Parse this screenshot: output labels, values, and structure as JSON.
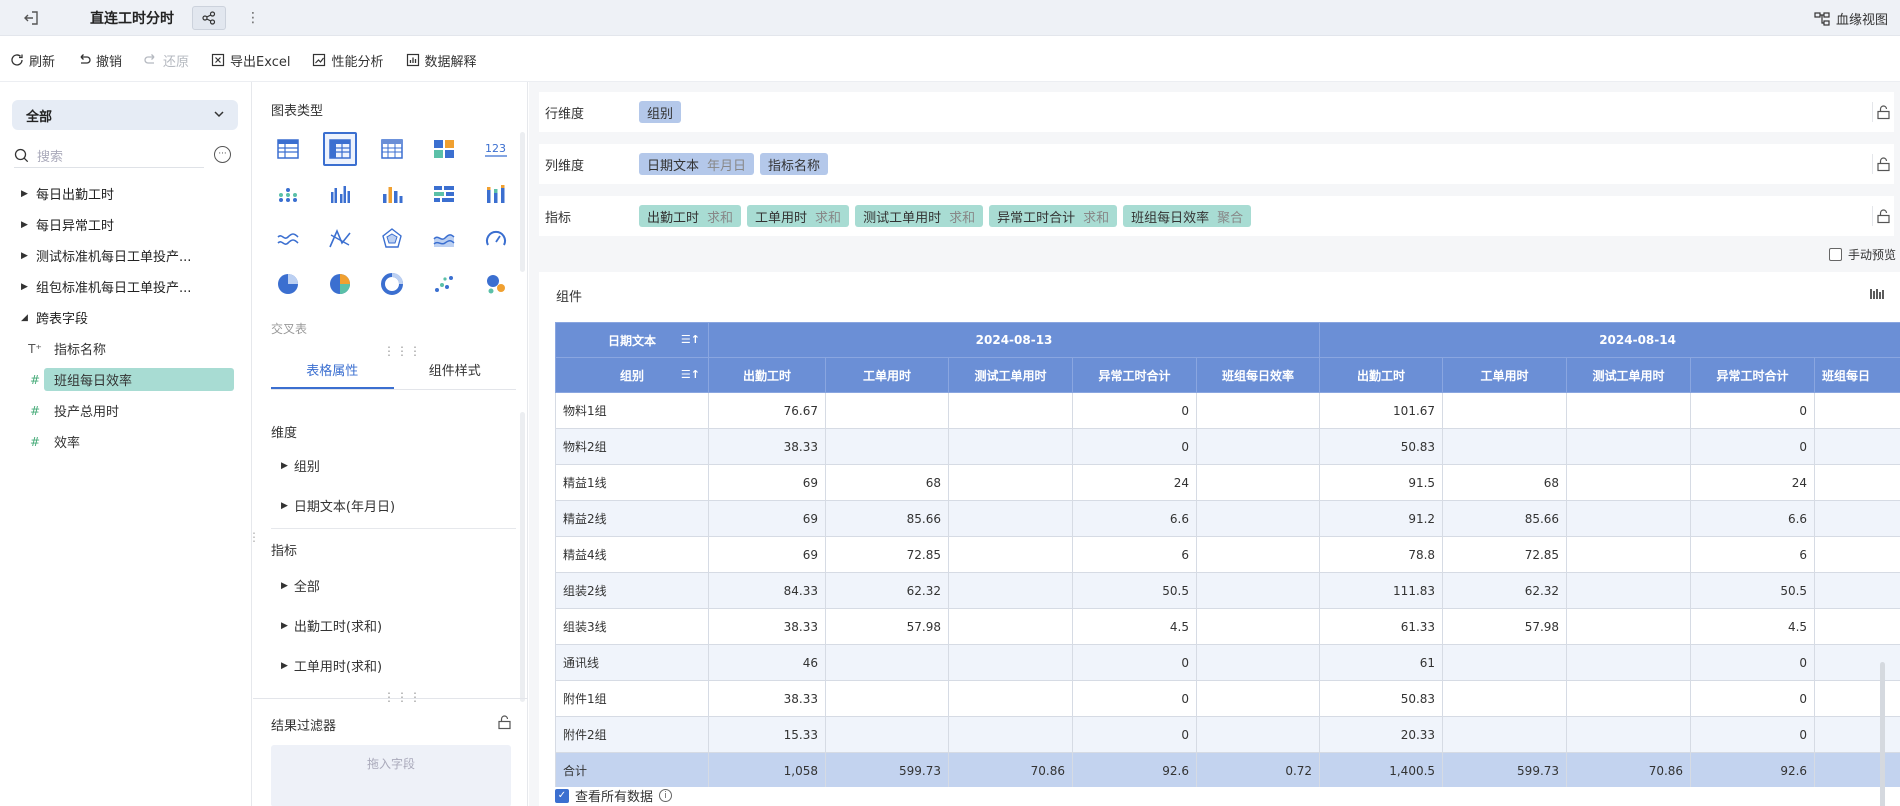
{
  "header": {
    "title": "直连工时分时",
    "lineage_label": "血缘视图"
  },
  "toolbar": {
    "refresh": "刷新",
    "undo": "撤销",
    "redo": "还原",
    "export": "导出Excel",
    "perf": "性能分析",
    "explain": "数据解释"
  },
  "left": {
    "scope": "全部",
    "search_placeholder": "搜索",
    "tree": [
      {
        "label": "每日出勤工时"
      },
      {
        "label": "每日异常工时"
      },
      {
        "label": "测试标准机每日工单投产..."
      },
      {
        "label": "组包标准机每日工单投产..."
      }
    ],
    "cross_group": "跨表字段",
    "cross_fields": [
      {
        "icon": "T⁺",
        "label": "指标名称"
      },
      {
        "icon": "#",
        "label": "班组每日效率"
      },
      {
        "icon": "#",
        "label": "投产总用时"
      },
      {
        "icon": "#",
        "label": "效率"
      }
    ]
  },
  "mid": {
    "chart_type_title": "图表类型",
    "cross_table": "交叉表",
    "tab_props": "表格属性",
    "tab_style": "组件样式",
    "dim_label": "维度",
    "dim_items": [
      "组别",
      "日期文本(年月日)"
    ],
    "mea_label": "指标",
    "mea_items": [
      "全部",
      "出勤工时(求和)",
      "工单用时(求和)"
    ],
    "filter_title": "结果过滤器",
    "filter_drop": "拖入字段"
  },
  "right": {
    "row_dim_label": "行维度",
    "row_dims": [
      {
        "name": "组别",
        "sub": ""
      }
    ],
    "col_dim_label": "列维度",
    "col_dims": [
      {
        "name": "日期文本",
        "sub": "年月日"
      },
      {
        "name": "指标名称",
        "sub": ""
      }
    ],
    "measure_label": "指标",
    "measures": [
      {
        "name": "出勤工时",
        "sub": "求和"
      },
      {
        "name": "工单用时",
        "sub": "求和"
      },
      {
        "name": "测试工单用时",
        "sub": "求和"
      },
      {
        "name": "异常工时合计",
        "sub": "求和"
      },
      {
        "name": "班组每日效率",
        "sub": "聚合"
      }
    ],
    "manual_preview": "手动预览",
    "component_title": "组件",
    "view_all": "查看所有数据"
  },
  "table": {
    "corner_top": "日期文本",
    "corner_bottom": "组别",
    "dates": [
      "2024-08-13",
      "2024-08-14"
    ],
    "metrics_a": [
      "出勤工时",
      "工单用时",
      "测试工单用时",
      "异常工时合计",
      "班组每日效率"
    ],
    "metrics_b": [
      "出勤工时",
      "工单用时",
      "测试工单用时",
      "异常工时合计",
      "班组每日"
    ],
    "rows": [
      {
        "group": "物料1组",
        "v": [
          "76.67",
          "",
          "",
          "0",
          "",
          "101.67",
          "",
          "",
          "0",
          ""
        ]
      },
      {
        "group": "物料2组",
        "v": [
          "38.33",
          "",
          "",
          "0",
          "",
          "50.83",
          "",
          "",
          "0",
          ""
        ]
      },
      {
        "group": "精益1线",
        "v": [
          "69",
          "68",
          "",
          "24",
          "",
          "91.5",
          "68",
          "",
          "24",
          ""
        ]
      },
      {
        "group": "精益2线",
        "v": [
          "69",
          "85.66",
          "",
          "6.6",
          "",
          "91.2",
          "85.66",
          "",
          "6.6",
          ""
        ]
      },
      {
        "group": "精益4线",
        "v": [
          "69",
          "72.85",
          "",
          "6",
          "",
          "78.8",
          "72.85",
          "",
          "6",
          ""
        ]
      },
      {
        "group": "组装2线",
        "v": [
          "84.33",
          "62.32",
          "",
          "50.5",
          "",
          "111.83",
          "62.32",
          "",
          "50.5",
          ""
        ]
      },
      {
        "group": "组装3线",
        "v": [
          "38.33",
          "57.98",
          "",
          "4.5",
          "",
          "61.33",
          "57.98",
          "",
          "4.5",
          ""
        ]
      },
      {
        "group": "通讯线",
        "v": [
          "46",
          "",
          "",
          "0",
          "",
          "61",
          "",
          "",
          "0",
          ""
        ]
      },
      {
        "group": "附件1组",
        "v": [
          "38.33",
          "",
          "",
          "0",
          "",
          "50.83",
          "",
          "",
          "0",
          ""
        ]
      },
      {
        "group": "附件2组",
        "v": [
          "15.33",
          "",
          "",
          "0",
          "",
          "20.33",
          "",
          "",
          "0",
          ""
        ]
      }
    ],
    "total": {
      "group": "合计",
      "v": [
        "1,058",
        "599.73",
        "70.86",
        "92.6",
        "0.72",
        "1,400.5",
        "599.73",
        "70.86",
        "92.6",
        ""
      ]
    }
  }
}
